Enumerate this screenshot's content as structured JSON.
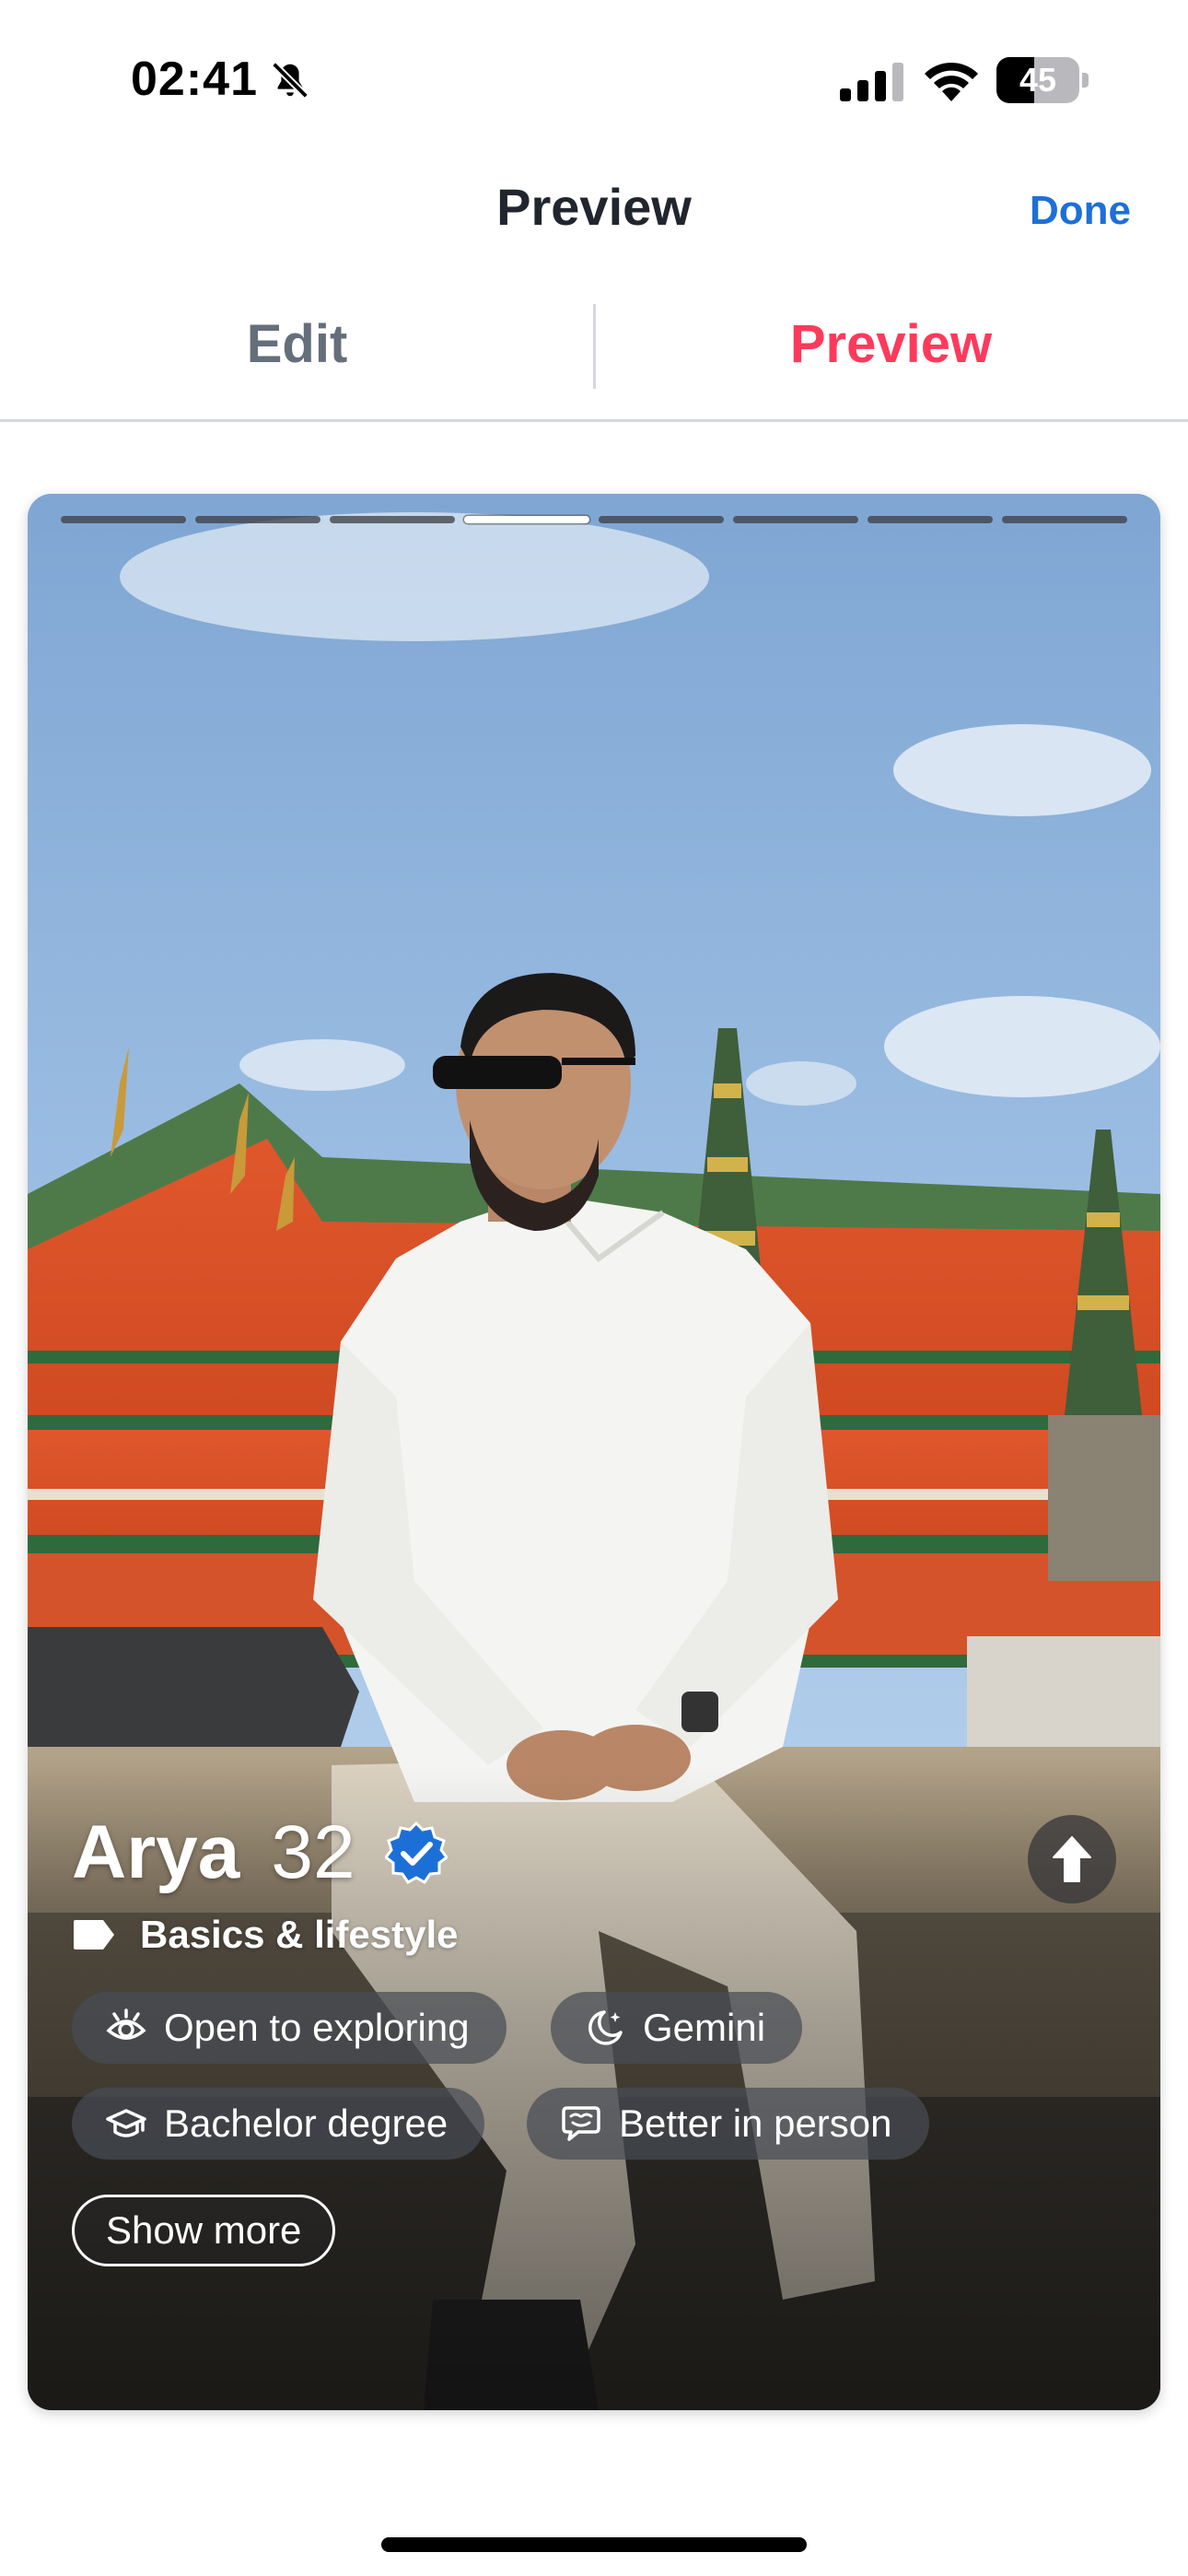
{
  "status_bar": {
    "time": "02:41",
    "battery_level": "45",
    "battery_fraction": 0.45,
    "icons": [
      "bell-off-icon",
      "signal-icon",
      "wifi-icon",
      "battery-icon"
    ]
  },
  "header": {
    "title": "Preview",
    "done_label": "Done"
  },
  "tabs": [
    {
      "label": "Edit",
      "active": false
    },
    {
      "label": "Preview",
      "active": true
    }
  ],
  "colors": {
    "accent_pink": "#fd3a5c",
    "link_blue": "#1d6fd8",
    "verified_blue": "#1d6fd8",
    "text_dark": "#21262e",
    "tab_inactive": "#656e7b"
  },
  "profile": {
    "photo_count": 8,
    "active_photo_index": 3,
    "name": "Arya",
    "age": "32",
    "verified": true,
    "section_label": "Basics & lifestyle",
    "section_icon": "tag-icon",
    "expand_icon": "arrow-up-icon",
    "chips": [
      {
        "icon": "eye-icon",
        "label": "Open to exploring"
      },
      {
        "icon": "moon-icon",
        "label": "Gemini"
      },
      {
        "icon": "graduation-cap-icon",
        "label": "Bachelor degree"
      },
      {
        "icon": "chat-bubble-icon",
        "label": "Better in person"
      }
    ],
    "show_more_label": "Show more"
  }
}
